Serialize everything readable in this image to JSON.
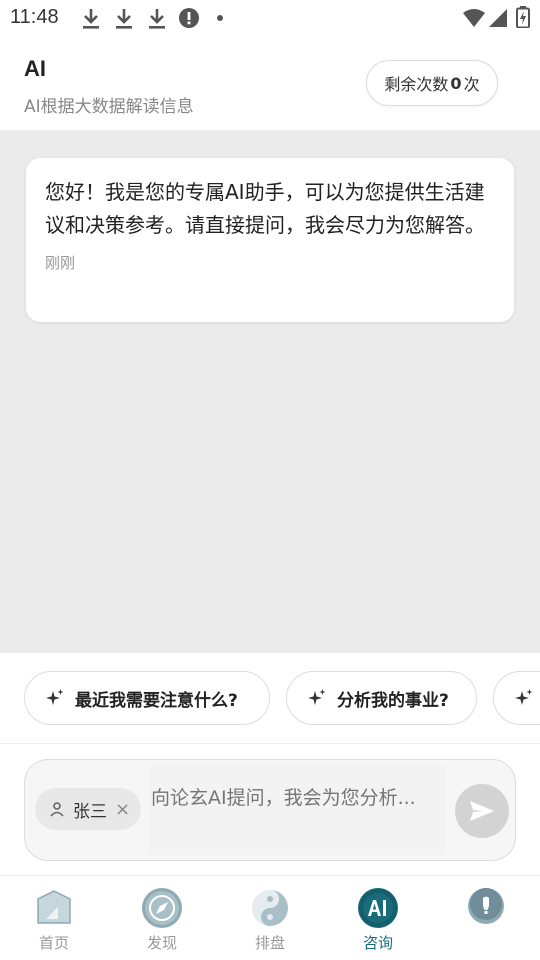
{
  "status_bar": {
    "time": "11:48"
  },
  "header": {
    "title": "AI",
    "subtitle": "AI根据大数据解读信息",
    "quota_prefix": "剩余次数",
    "quota_count": "0",
    "quota_suffix": "次"
  },
  "chat": {
    "messages": [
      {
        "text": "您好！我是您的专属AI助手，可以为您提供生活建议和决策参考。请直接提问，我会尽力为您解答。",
        "time": "刚刚"
      }
    ]
  },
  "suggestions": [
    {
      "label": "最近我需要注意什么?"
    },
    {
      "label": "分析我的事业?"
    },
    {
      "label": ""
    }
  ],
  "input": {
    "user_chip": "张三",
    "placeholder": "向论玄AI提问，我会为您分析..."
  },
  "nav": {
    "items": [
      {
        "label": "首页",
        "icon": "home-icon"
      },
      {
        "label": "发现",
        "icon": "compass-icon"
      },
      {
        "label": "排盘",
        "icon": "yin-yang-icon"
      },
      {
        "label": "咨询",
        "icon": "ai-icon"
      },
      {
        "label": "",
        "icon": "bulb-icon"
      }
    ],
    "active_index": 3
  },
  "colors": {
    "accent": "#1a6c7a",
    "chat_bg": "#ebebeb",
    "send_disabled": "#d3d3d3"
  }
}
